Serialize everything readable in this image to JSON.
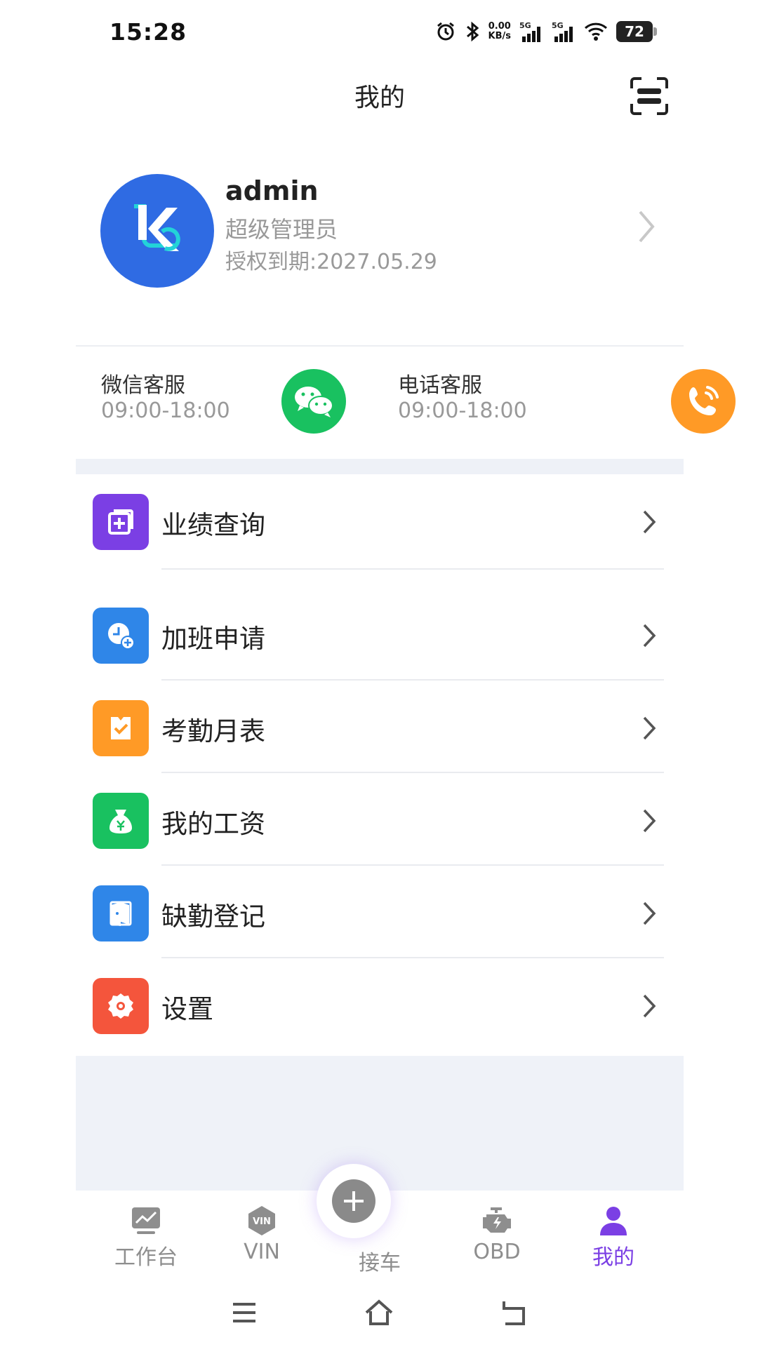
{
  "status_bar": {
    "time": "15:28",
    "net_speed_value": "0.00",
    "net_speed_unit": "KB/s",
    "signal_1": "5G",
    "signal_2": "5G",
    "battery": "72",
    "icons": [
      "alarm-icon",
      "bluetooth-icon",
      "signal-icon",
      "wifi-icon",
      "battery-icon"
    ]
  },
  "header": {
    "title": "我的",
    "scan_icon": "scan-icon"
  },
  "profile": {
    "username": "admin",
    "role": "超级管理员",
    "expiry": "授权到期:2027.05.29",
    "avatar_color": "#2f6be3"
  },
  "service": {
    "wechat": {
      "label": "微信客服",
      "hours": "09:00-18:00",
      "color": "#19c160",
      "icon": "wechat-icon"
    },
    "phone": {
      "label": "电话客服",
      "hours": "09:00-18:00",
      "color": "#ff9a26",
      "icon": "phone-icon"
    }
  },
  "menu": {
    "items": [
      {
        "label": "业绩查询",
        "color": "#7b3fe4",
        "icon": "performance-icon"
      },
      {
        "label": "加班申请",
        "color": "#2f86e8",
        "icon": "overtime-icon"
      },
      {
        "label": "考勤月表",
        "color": "#ff9a26",
        "icon": "attendance-icon"
      },
      {
        "label": "我的工资",
        "color": "#19c160",
        "icon": "salary-icon"
      },
      {
        "label": "缺勤登记",
        "color": "#2f86e8",
        "icon": "absence-icon"
      },
      {
        "label": "设置",
        "color": "#f4553c",
        "icon": "settings-icon"
      }
    ]
  },
  "tabbar": {
    "tabs": [
      {
        "label": "工作台",
        "icon": "dashboard-icon",
        "active": false
      },
      {
        "label": "VIN",
        "icon": "vin-icon",
        "active": false
      },
      {
        "label": "接车",
        "icon": "add-icon",
        "active": false
      },
      {
        "label": "OBD",
        "icon": "engine-icon",
        "active": false
      },
      {
        "label": "我的",
        "icon": "user-icon",
        "active": true
      }
    ],
    "active_color": "#7b3fe4"
  },
  "navbar": {
    "buttons": [
      "menu-icon",
      "home-icon",
      "back-icon"
    ]
  }
}
